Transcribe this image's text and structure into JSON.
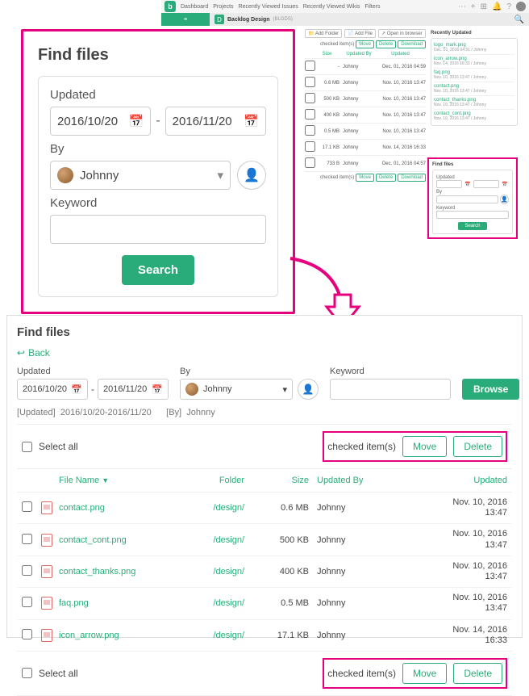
{
  "topnav": {
    "items": [
      "Dashboard",
      "Projects",
      "Recently Viewed Issues",
      "Recently Viewed Wikis",
      "Filters"
    ]
  },
  "project": {
    "name": "Backlog Design",
    "sub": "(BLGDS)"
  },
  "mini": {
    "toolbar": {
      "addFolder": "Add Folder",
      "addFile": "Add File",
      "openIn": "Open in browser"
    },
    "checked": "checked item(s)",
    "move": "Move",
    "delete": "Delete",
    "download": "Download",
    "head": {
      "size": "Size",
      "by": "Updated By",
      "upd": "Updated"
    },
    "rows": [
      {
        "size": "-",
        "by": "Johnny",
        "upd": "Dec. 01, 2016 04:59"
      },
      {
        "size": "0.6 MB",
        "by": "Johnny",
        "upd": "Nov. 10, 2016 13:47"
      },
      {
        "size": "500 KB",
        "by": "Johnny",
        "upd": "Nov. 10, 2016 13:47"
      },
      {
        "size": "400 KB",
        "by": "Johnny",
        "upd": "Nov. 10, 2016 13:47"
      },
      {
        "size": "0.5 MB",
        "by": "Johnny",
        "upd": "Nov. 10, 2016 13:47"
      },
      {
        "size": "17.1 KB",
        "by": "Johnny",
        "upd": "Nov. 14, 2016 16:33"
      },
      {
        "size": "733 B",
        "by": "Johnny",
        "upd": "Dec. 01, 2016 04:57"
      }
    ]
  },
  "recent": {
    "title": "Recently Updated",
    "items": [
      {
        "name": "logo_mark.png",
        "meta": "Dec. 01, 2016 04:51  /  Johnny"
      },
      {
        "name": "icon_arrow.png",
        "meta": "Nov. 14, 2016 16:33  /  Johnny"
      },
      {
        "name": "faq.png",
        "meta": "Nov. 10, 2016 13:47  /  Johnny"
      },
      {
        "name": "contact.png",
        "meta": "Nov. 10, 2016 13:47  /  Johnny"
      },
      {
        "name": "contact_thanks.png",
        "meta": "Nov. 10, 2016 13:47  /  Johnny"
      },
      {
        "name": "contact_cont.png",
        "meta": "Nov. 10, 2016 13:47  /  Johnny"
      }
    ]
  },
  "findMini": {
    "title": "Find files",
    "updated": "Updated",
    "by": "By",
    "keyword": "Keyword",
    "search": "Search"
  },
  "popup": {
    "title": "Find files",
    "updated": "Updated",
    "date_from": "2016/10/20",
    "date_to": "2016/11/20",
    "by": "By",
    "by_value": "Johnny",
    "keyword": "Keyword",
    "search": "Search"
  },
  "results": {
    "title": "Find files",
    "back": "Back",
    "labels": {
      "updated": "Updated",
      "by": "By",
      "keyword": "Keyword"
    },
    "date_from": "2016/10/20",
    "date_to": "2016/11/20",
    "by_value": "Johnny",
    "browse": "Browse",
    "applied_updated_label": "[Updated]",
    "applied_updated_value": "2016/10/20-2016/11/20",
    "applied_by_label": "[By]",
    "applied_by_value": "Johnny",
    "select_all": "Select all",
    "checked": "checked item(s)",
    "move": "Move",
    "delete": "Delete",
    "head": {
      "name": "File Name",
      "folder": "Folder",
      "size": "Size",
      "by": "Updated By",
      "upd": "Updated"
    },
    "rows": [
      {
        "name": "contact.png",
        "folder": "/design/",
        "size": "0.6 MB",
        "by": "Johnny",
        "upd1": "Nov. 10, 2016",
        "upd2": "13:47"
      },
      {
        "name": "contact_cont.png",
        "folder": "/design/",
        "size": "500 KB",
        "by": "Johnny",
        "upd1": "Nov. 10, 2016",
        "upd2": "13:47"
      },
      {
        "name": "contact_thanks.png",
        "folder": "/design/",
        "size": "400 KB",
        "by": "Johnny",
        "upd1": "Nov. 10, 2016",
        "upd2": "13:47"
      },
      {
        "name": "faq.png",
        "folder": "/design/",
        "size": "0.5 MB",
        "by": "Johnny",
        "upd1": "Nov. 10, 2016",
        "upd2": "13:47"
      },
      {
        "name": "icon_arrow.png",
        "folder": "/design/",
        "size": "17.1 KB",
        "by": "Johnny",
        "upd1": "Nov. 14, 2016",
        "upd2": "16:33"
      }
    ]
  }
}
